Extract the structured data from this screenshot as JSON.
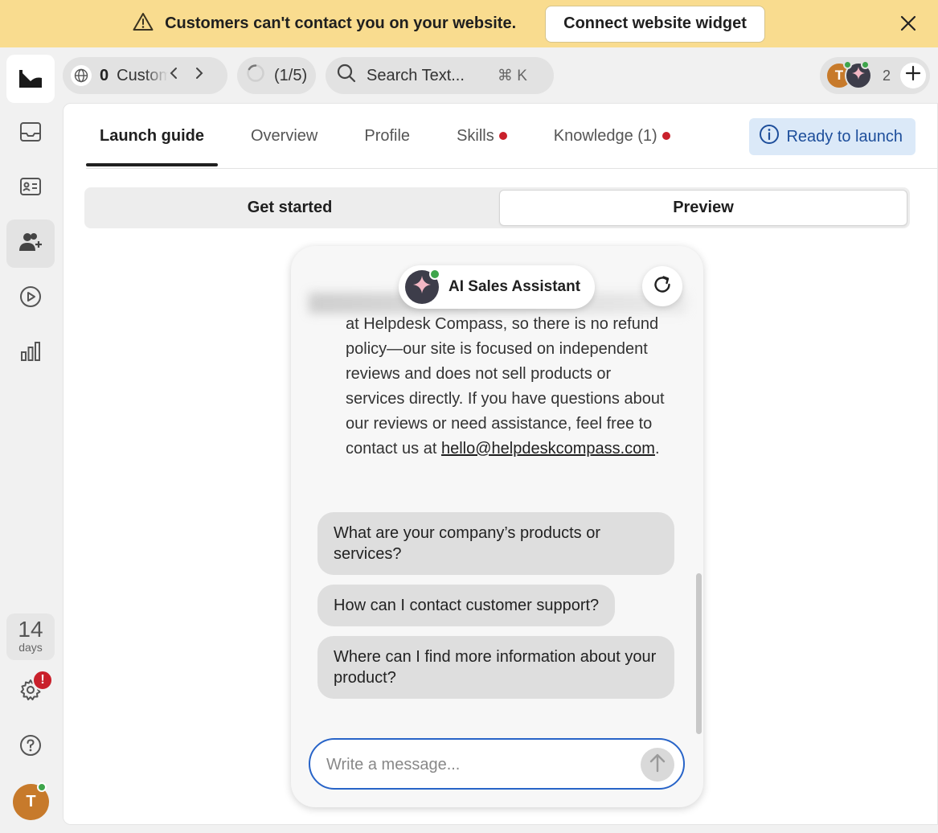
{
  "banner": {
    "text": "Customers can't contact you on your website.",
    "button_label": "Connect website widget",
    "bg_color": "#f9dc8f"
  },
  "toolbar": {
    "channel_count": "0",
    "channel_label": "Custom",
    "progress_label": "(1/5)",
    "search_placeholder": "Search Text...",
    "search_shortcut": "⌘ K",
    "agents_count": "2",
    "agent_initial": "T"
  },
  "rail": {
    "trial_days": "14",
    "trial_unit": "days",
    "settings_badge": "!",
    "user_initial": "T"
  },
  "tabs": [
    {
      "label": "Launch guide"
    },
    {
      "label": "Overview"
    },
    {
      "label": "Profile"
    },
    {
      "label": "Skills"
    },
    {
      "label": "Knowledge (1)"
    }
  ],
  "status": {
    "label": "Ready to launch",
    "color": "#1d4e9b"
  },
  "segments": {
    "left": "Get started",
    "right": "Preview"
  },
  "chat": {
    "title": "AI Sales Assistant",
    "message": "at Helpdesk Compass, so there is no refund policy—our site is focused on independent reviews and does not sell products or services directly. If you have questions about our reviews or need assistance, feel free to contact us at",
    "email": "hello@helpdeskcompass.com",
    "message_end": ".",
    "suggestions": [
      "What are your company’s products or services?",
      "How can I contact customer support?",
      "Where can I find more information about your product?"
    ],
    "input_placeholder": "Write a message...",
    "accent": "#2864c8"
  }
}
